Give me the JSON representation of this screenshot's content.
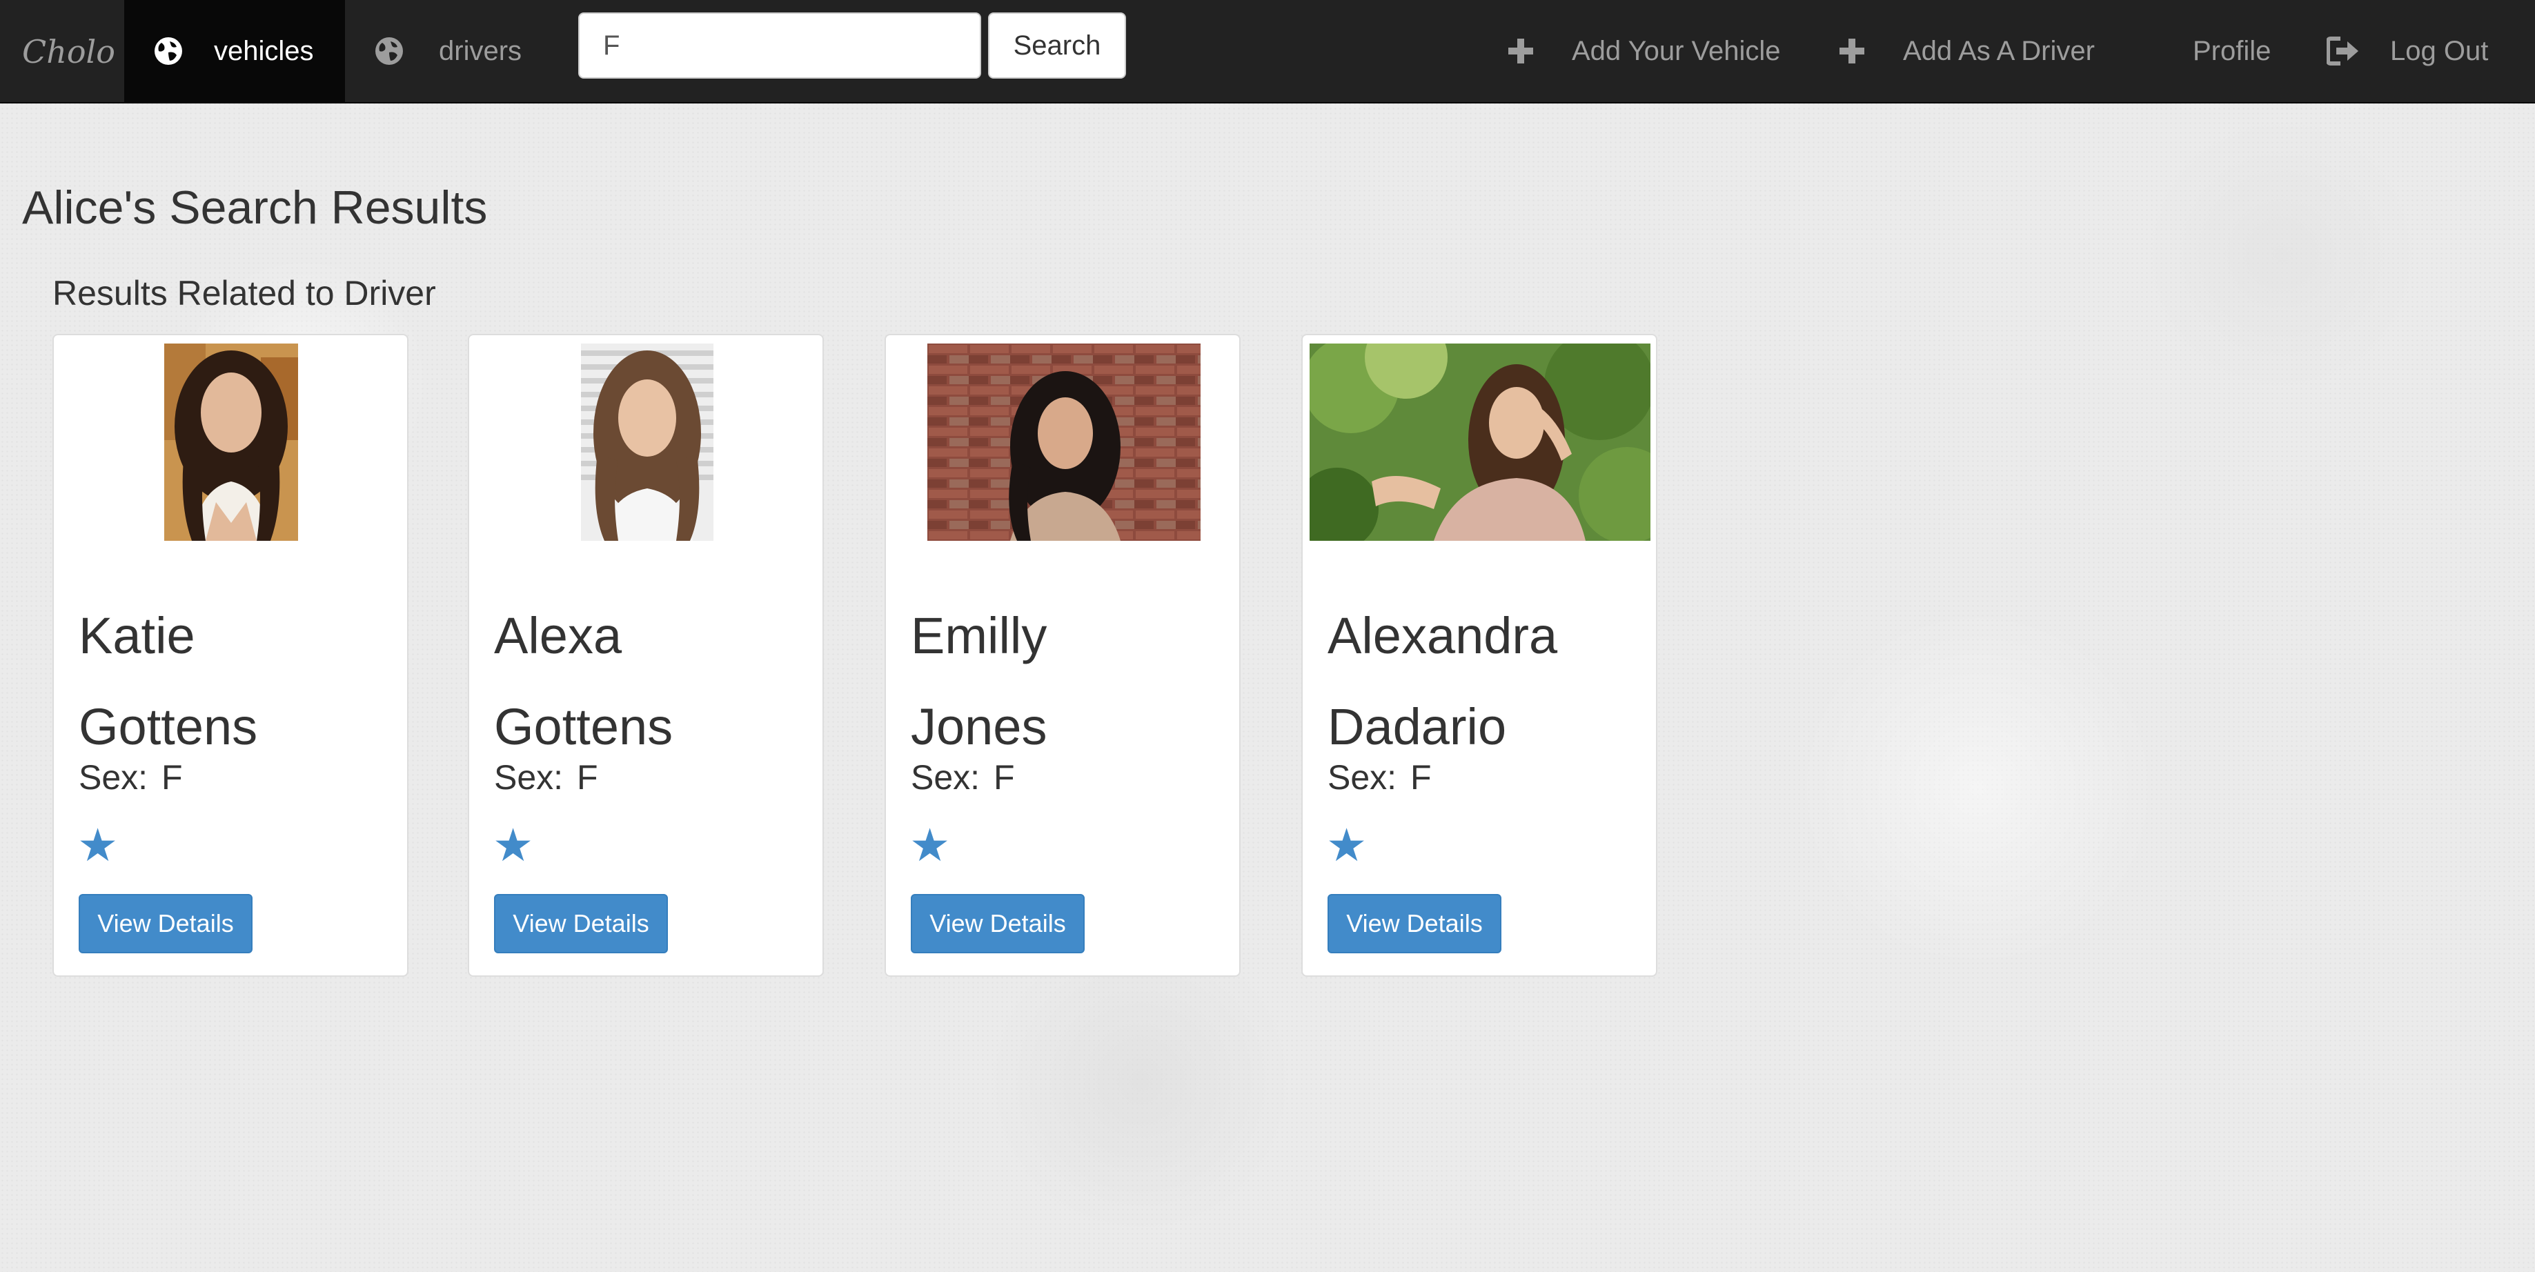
{
  "nav": {
    "brand": "Cholo",
    "vehicles_label": "vehicles",
    "drivers_label": "drivers",
    "search_value": "F",
    "search_button": "Search",
    "add_vehicle_label": "Add Your Vehicle",
    "add_driver_label": "Add As A Driver",
    "profile_label": "Profile",
    "logout_label": "Log Out",
    "icons": {
      "vehicles": "globe-icon",
      "drivers": "globe-icon",
      "add_vehicle": "plus-icon",
      "add_driver": "plus-icon",
      "logout": "log-out-icon"
    }
  },
  "main": {
    "title": "Alice's Search Results",
    "section_title": "Results Related to Driver"
  },
  "sex_label": "Sex:",
  "rating_icon": "star-icon",
  "accent_color": "#428bca",
  "drivers": [
    {
      "first_name": "Katie",
      "last_name": "Gottens",
      "sex": "F",
      "rating_stars": 1,
      "button": "View Details"
    },
    {
      "first_name": "Alexa",
      "last_name": "Gottens",
      "sex": "F",
      "rating_stars": 1,
      "button": "View Details"
    },
    {
      "first_name": "Emilly",
      "last_name": "Jones",
      "sex": "F",
      "rating_stars": 1,
      "button": "View Details"
    },
    {
      "first_name": "Alexandra",
      "last_name": "Dadario",
      "sex": "F",
      "rating_stars": 1,
      "button": "View Details"
    }
  ]
}
